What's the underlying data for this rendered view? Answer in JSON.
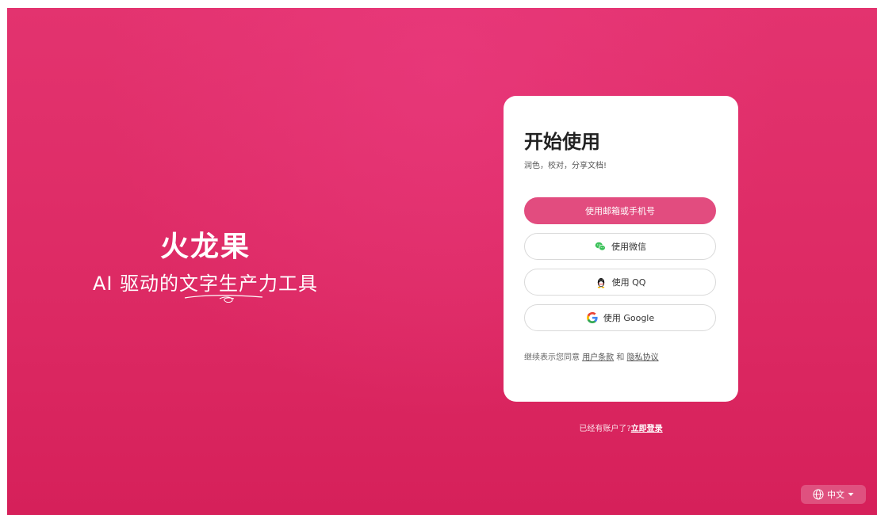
{
  "hero": {
    "title": "火龙果",
    "subtitle": "AI 驱动的文字生产力工具"
  },
  "card": {
    "title": "开始使用",
    "subtitle": "润色，校对，分享文档!",
    "buttons": {
      "email": "使用邮箱或手机号",
      "wechat": "使用微信",
      "qq": "使用 QQ",
      "google": "使用 Google"
    },
    "terms": {
      "prefix": "继续表示您同意",
      "user_terms": "用户条款",
      "and": "和",
      "privacy": "隐私协议"
    }
  },
  "login": {
    "prompt": "已经有账户了?",
    "link": "立即登录"
  },
  "language": {
    "current": "中文"
  },
  "colors": {
    "background": "#dd2a64",
    "primary_button": "#e24c7f",
    "card": "#ffffff"
  }
}
